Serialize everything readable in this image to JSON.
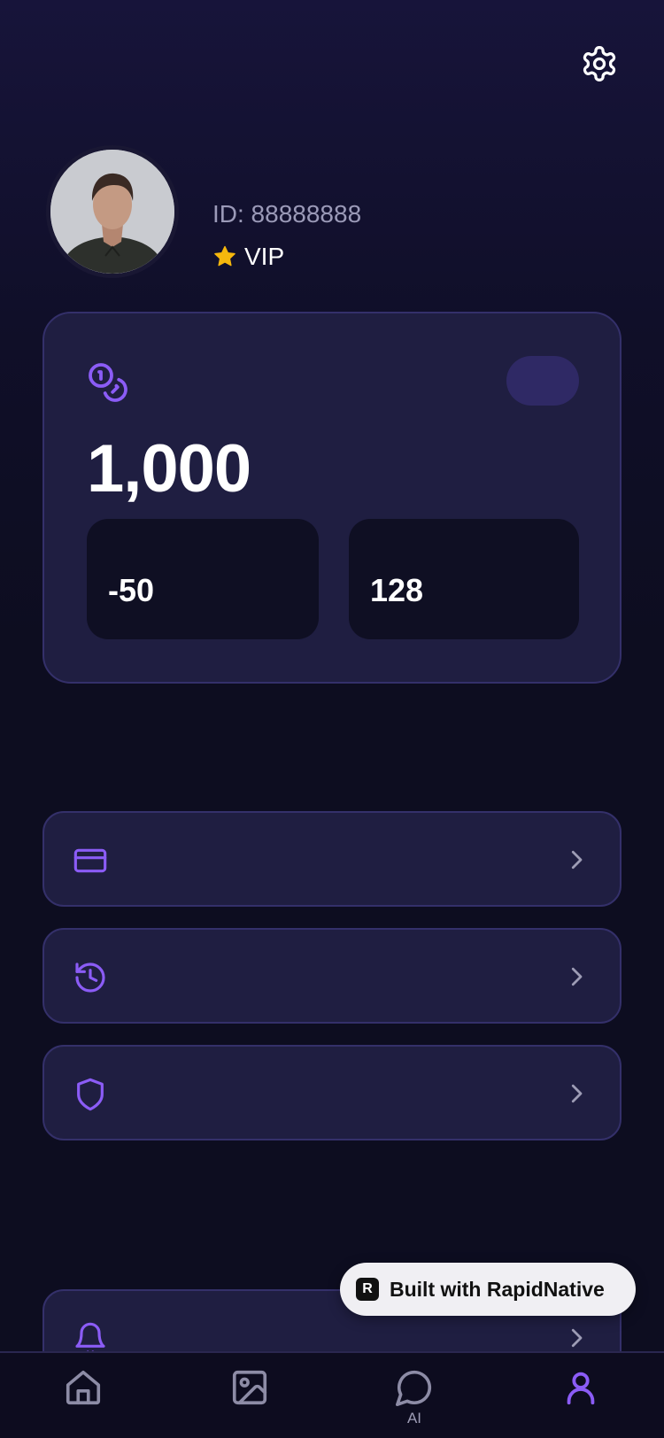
{
  "colors": {
    "accent": "#8b5cf6",
    "background": "#0d0d20",
    "card": "#1f1e41",
    "card_border": "#34306a",
    "star": "#f5b70d"
  },
  "header": {
    "settings_icon": "gear-icon"
  },
  "profile": {
    "id_text": "ID: 88888888",
    "tier": "VIP",
    "tier_icon": "star-icon"
  },
  "balance": {
    "icon": "coins-icon",
    "value": "1,000",
    "stats": [
      {
        "value": "-50"
      },
      {
        "value": "128"
      }
    ]
  },
  "menu": {
    "items": [
      {
        "icon": "credit-card-icon"
      },
      {
        "icon": "history-icon"
      },
      {
        "icon": "shield-icon"
      },
      {
        "icon": "bell-icon"
      }
    ]
  },
  "badge": {
    "text": "Built with RapidNative",
    "logo": "R"
  },
  "tabbar": {
    "tabs": [
      {
        "icon": "home-icon",
        "label": ""
      },
      {
        "icon": "image-icon",
        "label": ""
      },
      {
        "icon": "chat-icon",
        "label": "AI"
      },
      {
        "icon": "user-icon",
        "label": "",
        "active": true
      }
    ]
  }
}
